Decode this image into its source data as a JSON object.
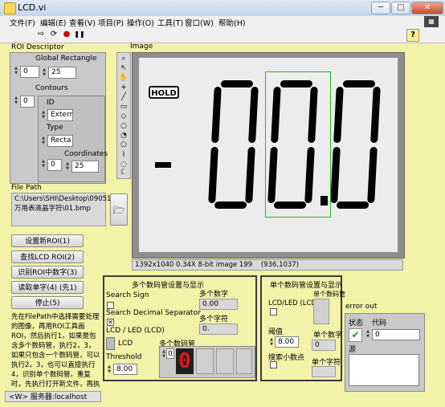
{
  "window": {
    "title": "LCD.vi",
    "ctrl_min": "─",
    "ctrl_max": "□",
    "ctrl_close": "✕"
  },
  "menu": [
    "文件(F)",
    "编辑(E)",
    "查看(V)",
    "项目(P)",
    "操作(O)",
    "工具(T)",
    "窗口(W)",
    "帮助(H)"
  ],
  "toolbar": {
    "run_arrow": "⇨",
    "run_cont": "⟳",
    "abort": "●",
    "pause": "❚❚",
    "help": "?"
  },
  "roi": {
    "title": "ROI Descriptor",
    "global_rect_label": "Global Rectangle",
    "index_outer": "0",
    "global_rect_value": "25",
    "contours_label": "Contours",
    "contour_index": "0",
    "id_label": "ID",
    "id_value": "Extern",
    "type_label": "Type",
    "type_value": "Recta",
    "coordinates_label": "Coordinates",
    "coord_index": "0",
    "coord_value": "25"
  },
  "filepath": {
    "label": "File Path",
    "value": "C:\\Users\\SHI\\Desktop\\090518 万用表液晶字符\\01.bmp"
  },
  "buttons": {
    "set_roi": "设置新ROI(1)",
    "find_roi": "查找LCD ROI(2)",
    "recognize": "识别ROI中数字(3)",
    "read_single": "读取单字(4) (先1)",
    "stop": "停止(5)"
  },
  "instructions": "先在FilePath中选择需要处理的图像，再用ROI工具画ROI，然后执行1，如果是包含多个数码管，执行2，3，如果只包含一个数码管，可以执行2，3，也可以直接执行4，识别单个数码管。重复时，先执行打开新文件，再执行3或执行4即可。停止程序执行5。",
  "image": {
    "label": "Image",
    "hold_text": "HOLD",
    "lcd_display": "-00.0",
    "info": "1392x1040 0.34X 8-bit image 199",
    "coords": "(936,1037)"
  },
  "multi": {
    "title": "多个数码管设置与显示",
    "search_sign": "Search Sign",
    "search_decimal": "Search Decimal Separator",
    "search_decimal_checked": "✕",
    "lcd_led_label": "LCD / LED (LCD)",
    "lcd_text": "LCD",
    "threshold_label": "Threshold",
    "threshold_value": "8.00",
    "multi_digit_label": "多个数字",
    "multi_digit_value": "0.00",
    "multi_char_label": "多个字符",
    "multi_char_value": "0.",
    "multi_led_label": "多个数码管",
    "multi_led_index": "0",
    "digit_shown": "0"
  },
  "single": {
    "title": "单个数码管设置与显示",
    "lcd_led_label": "LCD/LED (LCD)",
    "single_led_label": "单个数码管",
    "threshold_label": "阈值",
    "threshold_value": "8.00",
    "single_digit_label": "单个数字",
    "single_digit_value": "0",
    "search_dp_label": "搜索小数点",
    "single_char_label": "单个字符",
    "single_char_value": ""
  },
  "error": {
    "label": "error out",
    "status_label": "状态",
    "code_label": "代码",
    "status_mark": "✔",
    "code_value": "0",
    "source_label": "源"
  },
  "status": {
    "server": "<W>  服务器:localhost"
  },
  "colors": {
    "panel": "#f2f2a9",
    "lcd_border": "#22bb22",
    "led_red": "#e01818"
  }
}
